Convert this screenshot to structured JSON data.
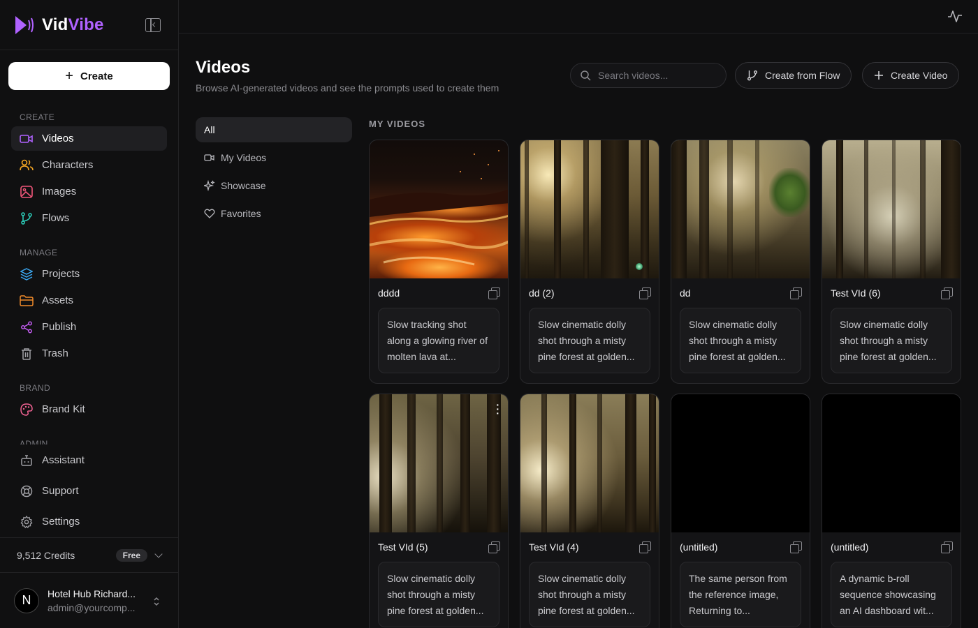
{
  "brand": {
    "name_part1": "Vid",
    "name_part2": "Vibe"
  },
  "sidebar": {
    "create_label": "Create",
    "sections": {
      "create": "CREATE",
      "manage": "MANAGE",
      "brand": "BRAND",
      "admin": "ADMIN"
    },
    "items": {
      "videos": "Videos",
      "characters": "Characters",
      "images": "Images",
      "flows": "Flows",
      "projects": "Projects",
      "assets": "Assets",
      "publish": "Publish",
      "trash": "Trash",
      "brand_kit": "Brand Kit",
      "assistant": "Assistant",
      "support": "Support",
      "settings": "Settings"
    },
    "credits": "9,512 Credits",
    "plan_badge": "Free",
    "user": {
      "avatar_letter": "N",
      "name": "Hotel Hub Richard...",
      "email": "admin@yourcomp..."
    }
  },
  "page": {
    "title": "Videos",
    "subtitle": "Browse AI-generated videos and see the prompts used to create them",
    "search_placeholder": "Search videos...",
    "create_from_flow": "Create from Flow",
    "create_video": "Create Video"
  },
  "filters": [
    "All",
    "My Videos",
    "Showcase",
    "Favorites"
  ],
  "section_label": "MY VIDEOS",
  "videos": [
    {
      "title": "dddd",
      "prompt": "Slow tracking shot along a glowing river of molten lava at..."
    },
    {
      "title": "dd (2)",
      "prompt": "Slow cinematic dolly shot through a misty pine forest at golden..."
    },
    {
      "title": "dd",
      "prompt": "Slow cinematic dolly shot through a misty pine forest at golden..."
    },
    {
      "title": "Test VId (6)",
      "prompt": "Slow cinematic dolly shot through a misty pine forest at golden..."
    },
    {
      "title": "Test VId (5)",
      "prompt": "Slow cinematic dolly shot through a misty pine forest at golden..."
    },
    {
      "title": "Test VId (4)",
      "prompt": "Slow cinematic dolly shot through a misty pine forest at golden..."
    },
    {
      "title": "(untitled)",
      "prompt": "The same person from the reference image, Returning to..."
    },
    {
      "title": "(untitled)",
      "prompt": "A dynamic b-roll sequence showcasing an AI dashboard wit..."
    }
  ],
  "colors": {
    "accent": "#b062ff",
    "background": "#0f0f10",
    "sidebar": "#101011"
  }
}
